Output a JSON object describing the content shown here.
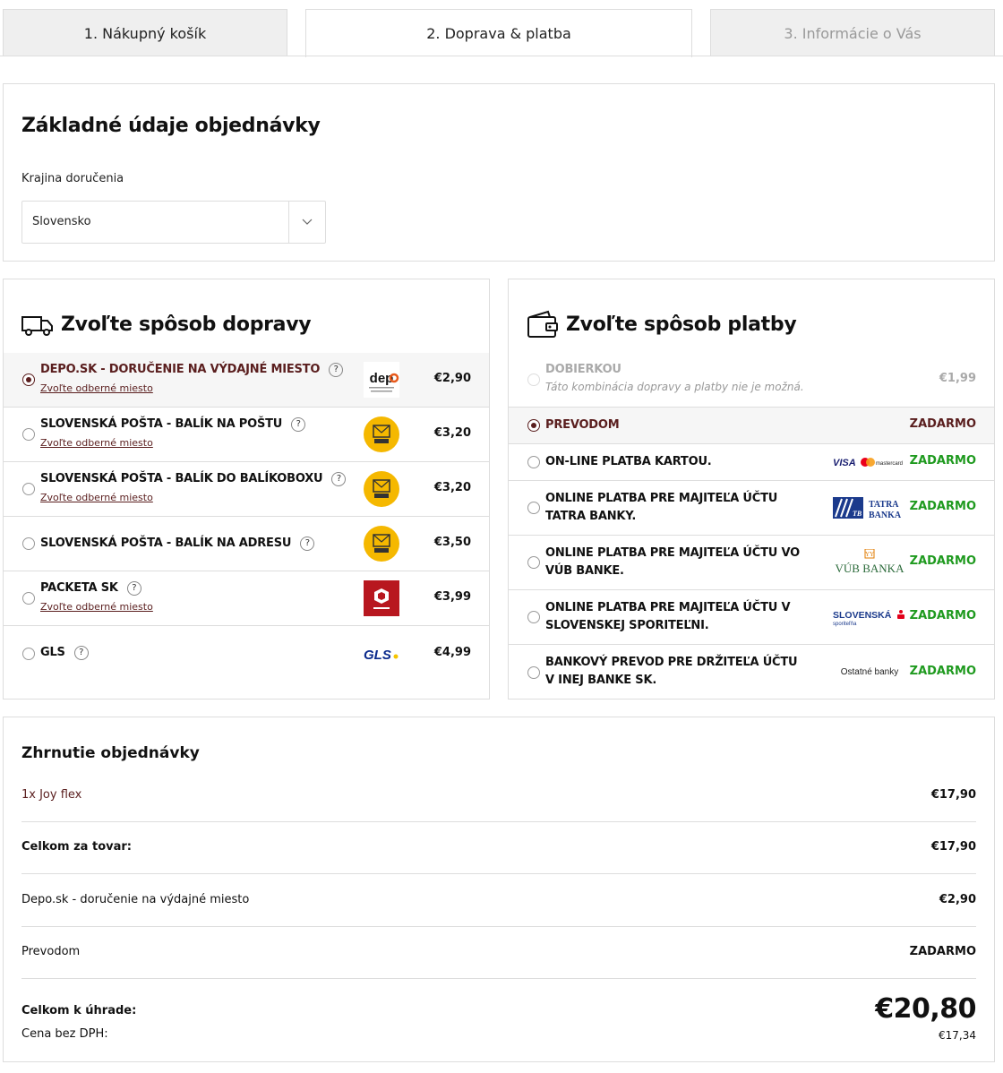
{
  "steps": [
    {
      "label": "1. Nákupný košík"
    },
    {
      "label": "2. Doprava & platba"
    },
    {
      "label": "3. Informácie o Vás"
    }
  ],
  "basic": {
    "title": "Základné údaje objednávky",
    "country_label": "Krajina doručenia",
    "country_value": "Slovensko"
  },
  "shipping": {
    "title": "Zvoľte spôsob dopravy",
    "items": [
      {
        "name": "DEPO.SK - DORUČENIE NA VÝDAJNÉ MIESTO",
        "sub": "Zvoľte odberné miesto",
        "price": "€2,90",
        "logo": "depo-logo",
        "selected": true
      },
      {
        "name": "SLOVENSKÁ POŠTA - BALÍK NA POŠTU",
        "sub": "Zvoľte odberné miesto",
        "price": "€3,20",
        "logo": "posta-logo"
      },
      {
        "name": "SLOVENSKÁ POŠTA - BALÍK DO BALÍKOBOXU",
        "sub": "Zvoľte odberné miesto",
        "price": "€3,20",
        "logo": "posta-logo"
      },
      {
        "name": "SLOVENSKÁ POŠTA - BALÍK NA ADRESU",
        "sub": "",
        "price": "€3,50",
        "logo": "posta-logo"
      },
      {
        "name": "PACKETA SK",
        "sub": "Zvoľte odberné miesto",
        "price": "€3,99",
        "logo": "packeta-logo"
      },
      {
        "name": "GLS",
        "sub": "",
        "price": "€4,99",
        "logo": "gls-logo"
      }
    ],
    "help": "?"
  },
  "payment": {
    "title": "Zvoľte spôsob platby",
    "items": [
      {
        "name": "DOBIERKOU",
        "note": "Táto kombinácia dopravy a platby nie je možná.",
        "price": "€1,99",
        "disabled": true
      },
      {
        "name": "PREVODOM",
        "price": "ZADARMO",
        "selected": true
      },
      {
        "name": "ON-LINE PLATBA KARTOU.",
        "price": "ZADARMO",
        "logo": "visa-mastercard-logo"
      },
      {
        "name": "ONLINE PLATBA PRE MAJITEĽA ÚČTU TATRA BANKY.",
        "price": "ZADARMO",
        "logo": "tatra-banka-logo"
      },
      {
        "name": "ONLINE PLATBA PRE MAJITEĽA ÚČTU VO VÚB BANKE.",
        "price": "ZADARMO",
        "logo": "vub-banka-logo"
      },
      {
        "name": "ONLINE PLATBA PRE MAJITEĽA ÚČTU V SLOVENSKEJ SPORITEĽNI.",
        "price": "ZADARMO",
        "logo": "slovenska-sporitelna-logo"
      },
      {
        "name": "BANKOVÝ PREVOD PRE DRŽITEĽA ÚČTU V INEJ BANKE SK.",
        "price": "ZADARMO",
        "logo_text": "Ostatné banky"
      }
    ]
  },
  "summary": {
    "title": "Zhrnutie objednávky",
    "product": {
      "label": "1x Joy flex",
      "value": "€17,90"
    },
    "goods_total": {
      "label": "Celkom za tovar:",
      "value": "€17,90"
    },
    "shipping": {
      "label": "Depo.sk - doručenie na výdajné miesto",
      "value": "€2,90"
    },
    "payment": {
      "label": "Prevodom",
      "value": "ZADARMO"
    },
    "total_label": "Celkom k úhrade:",
    "total_value": "€20,80",
    "net_label": "Cena bez DPH:",
    "net_value": "€17,34"
  },
  "colors": {
    "accent": "#5a1e1e",
    "free": "#1f9a1f",
    "border": "#dddddd"
  }
}
